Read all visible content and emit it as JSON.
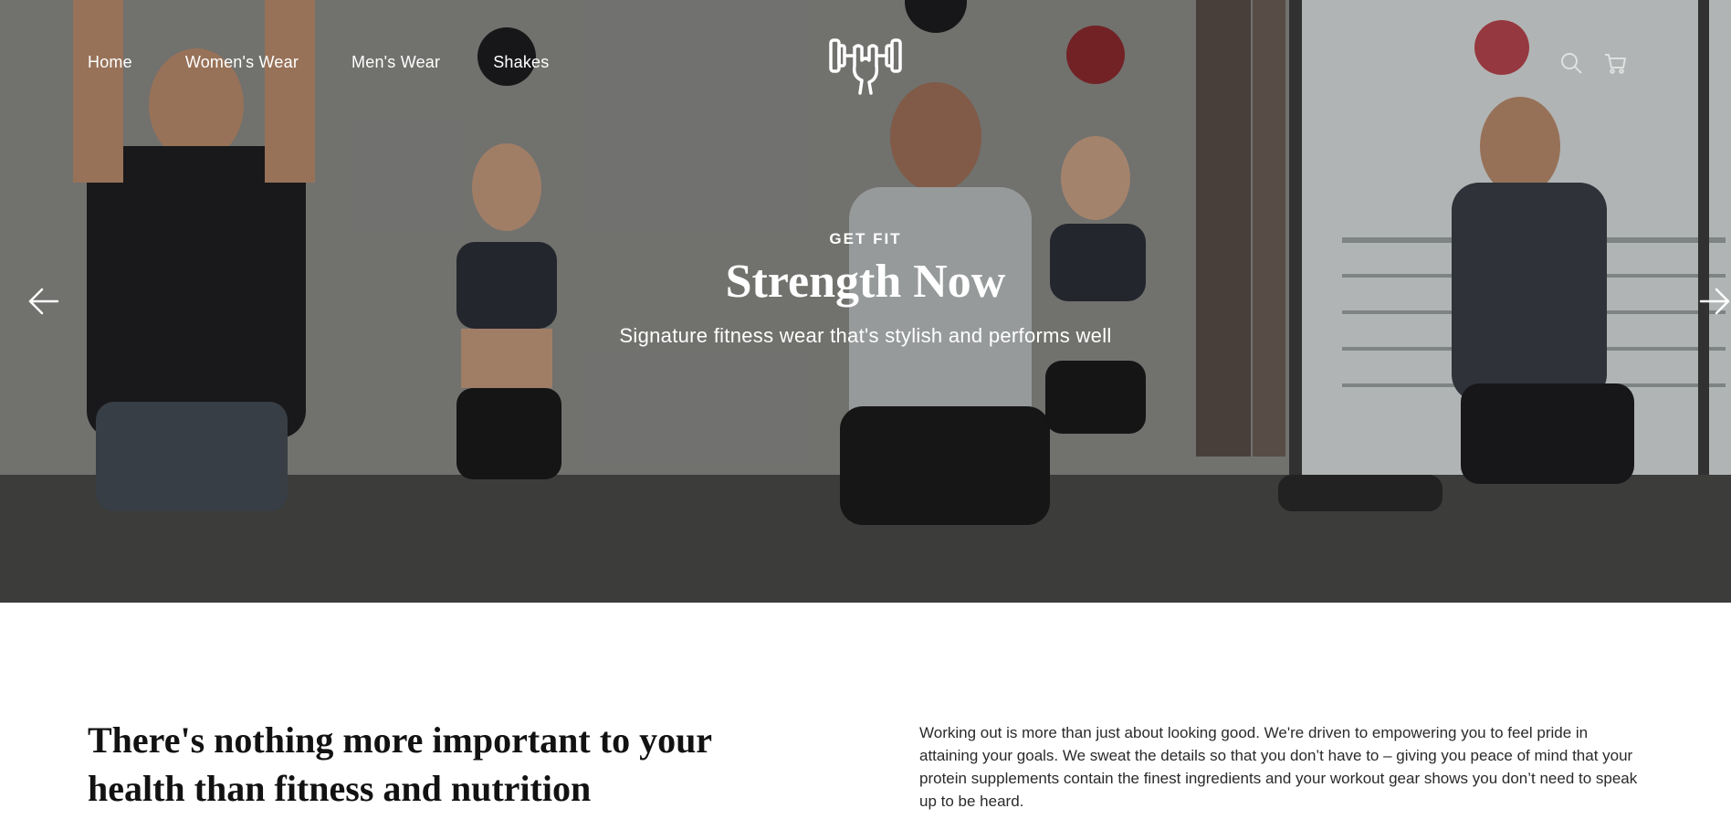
{
  "nav": {
    "items": [
      "Home",
      "Women's Wear",
      "Men's Wear",
      "Shakes"
    ]
  },
  "hero": {
    "kicker": "GET FIT",
    "title": "Strength Now",
    "subtitle": "Signature fitness wear that's stylish and performs well"
  },
  "intro": {
    "heading": "There's nothing more important to your health than fitness and nutrition",
    "body": "Working out is more than just about looking good. We're driven to empowering you to feel pride in attaining your goals. We sweat the details so that you don’t have to – giving you peace of mind that your protein supplements contain the finest ingredients and your workout gear shows you don’t need to speak up to be heard."
  },
  "icons": {
    "logo": "flexed-arm-dumbbell-logo",
    "search": "search-icon",
    "cart": "cart-icon",
    "prev": "arrow-left-icon",
    "next": "arrow-right-icon"
  },
  "colors": {
    "hero_text": "#ffffff",
    "heading": "#121212",
    "body_text": "#2a2a2a",
    "page_bg": "#ffffff"
  }
}
